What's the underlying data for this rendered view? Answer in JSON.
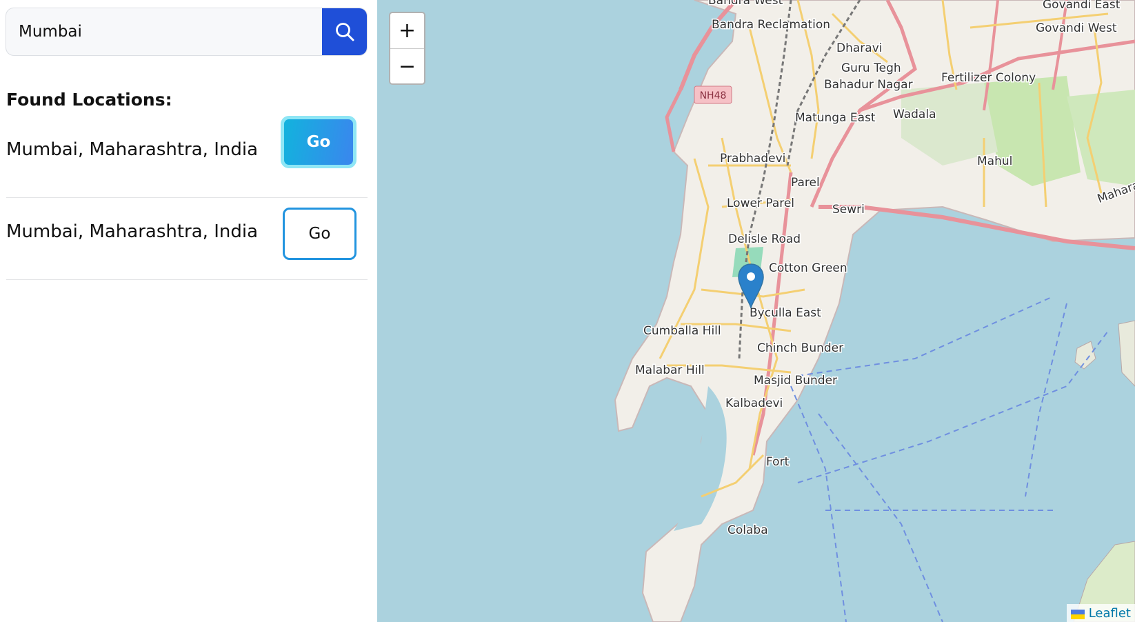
{
  "search": {
    "value": "Mumbai",
    "button_icon": "search-icon"
  },
  "results": {
    "heading": "Found Locations:",
    "items": [
      {
        "label": "Mumbai, Maharashtra, India",
        "button_label": "Go",
        "style": "selected"
      },
      {
        "label": "Mumbai, Maharashtra, India",
        "button_label": "Go",
        "style": "outline"
      }
    ]
  },
  "map": {
    "zoom_in_label": "+",
    "zoom_out_label": "−",
    "attribution": "Leaflet",
    "marker_icon": "map-pin-icon",
    "places": {
      "bandra_west": "Bandra West",
      "bandra_reclamation": "Bandra Reclamation",
      "govandi_east": "Govandi East",
      "govandi_west": "Govandi West",
      "dharavi": "Dharavi",
      "guru_tegh": "Guru Tegh",
      "bahadur_nagar": "Bahadur Nagar",
      "fertilizer_colony": "Fertilizer Colony",
      "nh48": "NH48",
      "matunga_east": "Matunga East",
      "wadala": "Wadala",
      "mahul": "Mahul",
      "prabhadevi": "Prabhadevi",
      "parel": "Parel",
      "lower_parel": "Lower Parel",
      "sewri": "Sewri",
      "delisle_road": "Delisle Road",
      "cotton_green": "Cotton Green",
      "byculla_east": "Byculla East",
      "cumballa_hill": "Cumballa Hill",
      "chinch_bunder": "Chinch Bunder",
      "malabar_hill": "Malabar Hill",
      "masjid_bunder": "Masjid Bunder",
      "kalbadevi": "Kalbadevi",
      "fort": "Fort",
      "colaba": "Colaba",
      "maharashtra": "Maharas"
    },
    "colors": {
      "water": "#abd2de",
      "land": "#f2efe9",
      "road_major": "#e8929a",
      "road_minor": "#f7dc8e",
      "marker": "#2a81cb"
    }
  }
}
